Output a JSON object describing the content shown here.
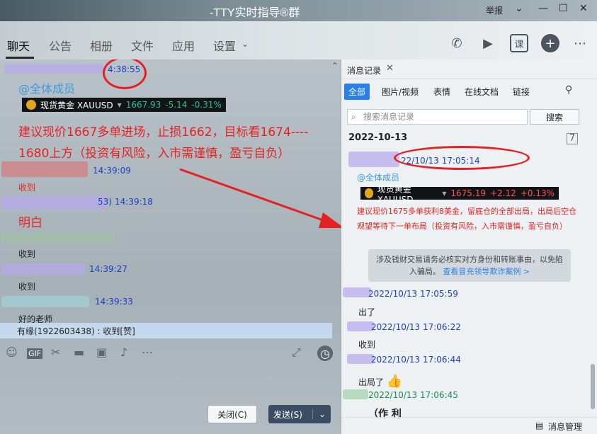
{
  "window": {
    "title": "-TTY实时指导®群",
    "report": "举报"
  },
  "tabs": [
    "聊天",
    "公告",
    "相册",
    "文件",
    "应用",
    "设置"
  ],
  "left": {
    "m1": {
      "time": "4:38:55",
      "mention": "@全体成员",
      "ticker": {
        "name": "现货黄金 XAUUSD",
        "price": "1667.93",
        "change": "-5.14",
        "pct": "-0.31%"
      },
      "text1": "建议现价1667多单进场，止损1662，目标看1674----",
      "text2": "1680上方（投资有风险，入市需谨慎，盈亏自负）"
    },
    "m2": {
      "time": "14:39:09",
      "text": "收到"
    },
    "m3": {
      "time": "14:39:18",
      "id_suffix": "53)",
      "text": "明白"
    },
    "m4": {
      "text": "收到"
    },
    "m5": {
      "time": "14:39:27",
      "text": "收到"
    },
    "m6": {
      "time": "14:39:33",
      "text": "好的老师"
    },
    "notice": "有缘(1922603438) : 收到[赞]",
    "buttons": {
      "close": "关闭(C)",
      "send": "发送(S)"
    }
  },
  "right": {
    "panel_title": "消息记录",
    "filters": [
      "全部",
      "图片/视频",
      "表情",
      "在线文档",
      "链接"
    ],
    "search_placeholder": "搜索消息记录",
    "search_button": "搜索",
    "date": "2022-10-13",
    "r1": {
      "time": "22/10/13 17:05:14",
      "mention": "@全体成员",
      "ticker": {
        "name": "现货黄金 XAUUSD",
        "price": "1675.19",
        "change": "+2.12",
        "pct": "+0.13%"
      },
      "text": "建议现价1675多单获利8美金，留底仓的全部出局，出局后空仓观望等待下一单布局（投资有风险，入市需谨慎，盈亏自负）"
    },
    "warn": "涉及钱财交易请务必核实对方身份和转账事由，以免陷入骗局。",
    "warn_link": "查看冒充领导欺诈案例 >",
    "r2": {
      "time": "2022/10/13 17:05:59",
      "text": "出了"
    },
    "r3": {
      "time": "2022/10/13 17:06:22",
      "text": "收到"
    },
    "r4": {
      "time": "2022/10/13 17:06:44",
      "text": "出局了"
    },
    "r5": {
      "time": "2022/10/13 17:06:45",
      "text": "（作 利"
    },
    "footer": "消息管理"
  },
  "colors": {
    "accent": "#2a7fe8",
    "red_text": "#e52222",
    "time_blue": "#1a3fc4"
  }
}
